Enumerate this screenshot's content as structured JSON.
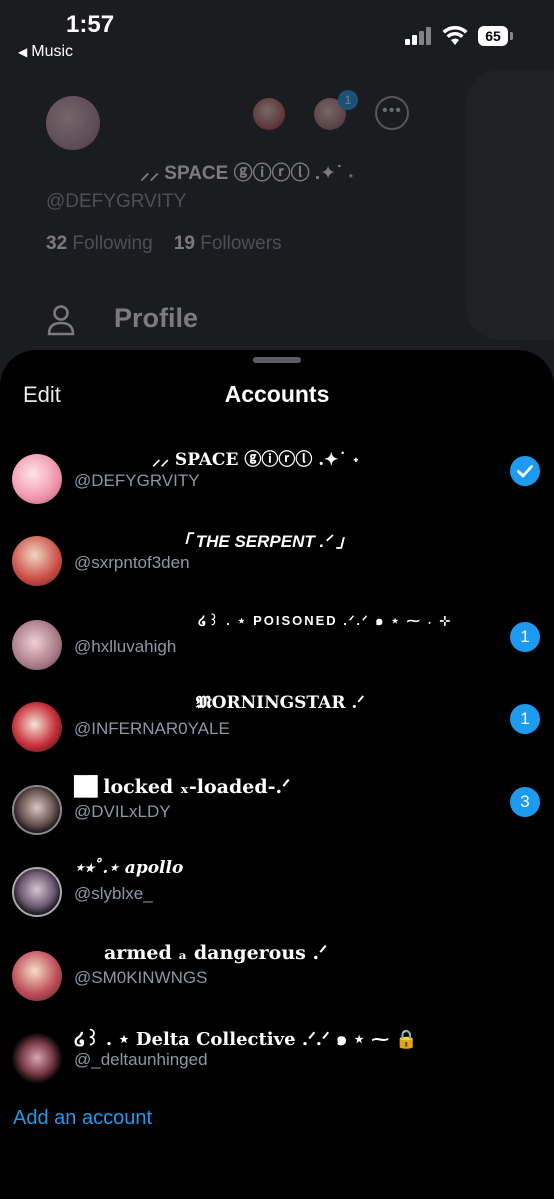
{
  "status_bar": {
    "time": "1:57",
    "back_app": "Music",
    "battery": "65"
  },
  "background_profile": {
    "display_name": "⸝⸝ SPACE ⓖⓘⓡⓛ .✦˙ ˖",
    "handle": "@DEFYGRVITY",
    "following_count": "32",
    "following_label": "Following",
    "followers_count": "19",
    "followers_label": "Followers",
    "badge_count": "1",
    "menu_item": "Profile"
  },
  "sheet": {
    "edit_label": "Edit",
    "title": "Accounts",
    "add_account_label": "Add an account"
  },
  "accounts": [
    {
      "name": "⸝⸝ SPACE ⓖⓘⓡⓛ .✦˙ ˖",
      "handle": "@DEFYGRVITY",
      "selected": true,
      "badge": ""
    },
    {
      "name": "「 THE SERPENT .ᐟ 」",
      "handle": "@sxrpntof3den",
      "selected": false,
      "badge": ""
    },
    {
      "name": "໒꒱ . ⋆ POISONED .ᐟ.ᐟ ๑ ⋆ ⁓ ˖ ⊹",
      "handle": "@hxlluvahigh",
      "selected": false,
      "badge": "1"
    },
    {
      "name": "𝕸ORNINGSTAR .ᐟ",
      "handle": "@INFERNAR0YALE",
      "selected": false,
      "badge": "1"
    },
    {
      "name": "█▋locked ₓ-loaded-.ᐟ",
      "handle": "@DVILxLDY",
      "selected": false,
      "badge": "3"
    },
    {
      "name": "⋆⭒˚.⋆ apollo",
      "handle": "@slyblxe_",
      "selected": false,
      "badge": ""
    },
    {
      "name": "armed ₐ dangerous .ᐟ",
      "handle": "@SM0KINWNGS",
      "selected": false,
      "badge": ""
    },
    {
      "name": "໒꒱ . ⋆ Delta Collective .ᐟ.ᐟ ๑ ⋆ ⁓ 🔒",
      "handle": "@_deltaunhinged",
      "selected": false,
      "badge": ""
    }
  ],
  "colors": {
    "accent": "#1d9bf0",
    "sheet_bg": "#000000",
    "handle_gray": "#8b98a5"
  }
}
